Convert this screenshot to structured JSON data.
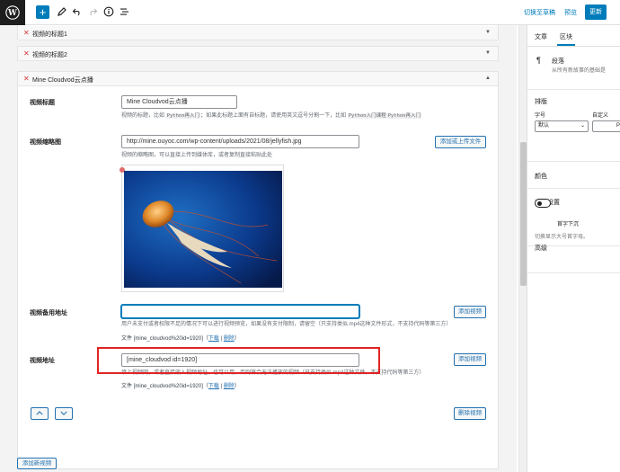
{
  "toolbar": {
    "switch_draft": "切换至草稿",
    "preview": "预览",
    "publish": "更新"
  },
  "collapsed_boxes": [
    {
      "title": "视频的标题1"
    },
    {
      "title": "视频的标题2"
    }
  ],
  "main_box": {
    "title": "Mine Cloudvod云点播",
    "fields": {
      "video_title": {
        "label": "视频标题",
        "value": "Mine Cloudvod云点播",
        "desc_a": "视频的标题，比如",
        "desc_code1": "Python再入门",
        "desc_b": "；如果此标题上面有自标题，请使用英文逗号分割一下，比如",
        "desc_code2": "Python入门课程",
        "desc_code3": "Python再入门"
      },
      "thumbnail": {
        "label": "视频缩略图",
        "value": "http://mine.ouyoc.com/wp-content/uploads/2021/08/jellyfish.jpg",
        "button": "添加或上传文件",
        "desc": "视频的缩略图，可以直接上传到媒体库，或者复制直接粘贴此处"
      },
      "backup_url": {
        "label": "视频备用地址",
        "value": "",
        "button": "添加视频",
        "desc": "用户未支付或者权限不足的情况下可以进行视频预览，如果没有支付限制，请留空（只支持类似.mp4这种文件形式，不支持代码等第三方）",
        "file_prefix": "文件 [mine_cloudvod%20id=1920]",
        "file_edit": "下载",
        "file_sep": "|",
        "file_remove": "删除"
      },
      "video_url": {
        "label": "视频地址",
        "value": "[mine_cloudvod id=1920]",
        "button": "添加视频",
        "desc": "填上视频网，或者直接嵌入视频地址，也可以用，否则将会无法播放的视频（只支持类似.mp4这种文件，不支持代码等第三方）",
        "file_prefix": "文件 [mine_cloudvod%20id=1920]",
        "file_edit": "下载",
        "file_sep": "|",
        "file_remove": "删除"
      }
    },
    "up_label": "⌃",
    "down_label": "⌄",
    "delete_button": "删除视频"
  },
  "add_video_button": "添加新视频",
  "sidebar": {
    "tabs": [
      "文章",
      "区块"
    ],
    "active_tab": 1,
    "block": {
      "name": "段落",
      "desc": "从所有新故事的基础是"
    },
    "typography": {
      "title": "排版",
      "font_size_label": "字号",
      "custom_label": "自定义",
      "font_size_value": "默认",
      "custom_value": "PX"
    },
    "color": {
      "title": "颜色"
    },
    "text_settings": {
      "title": "文本设置",
      "drop_cap_label": "首字下沉",
      "drop_cap_desc": "切换显示大号首字母。"
    },
    "advanced": {
      "title": "高级"
    }
  },
  "colors": {
    "accent": "#007cba",
    "danger": "#d63638",
    "highlight_box": "#e02424"
  }
}
